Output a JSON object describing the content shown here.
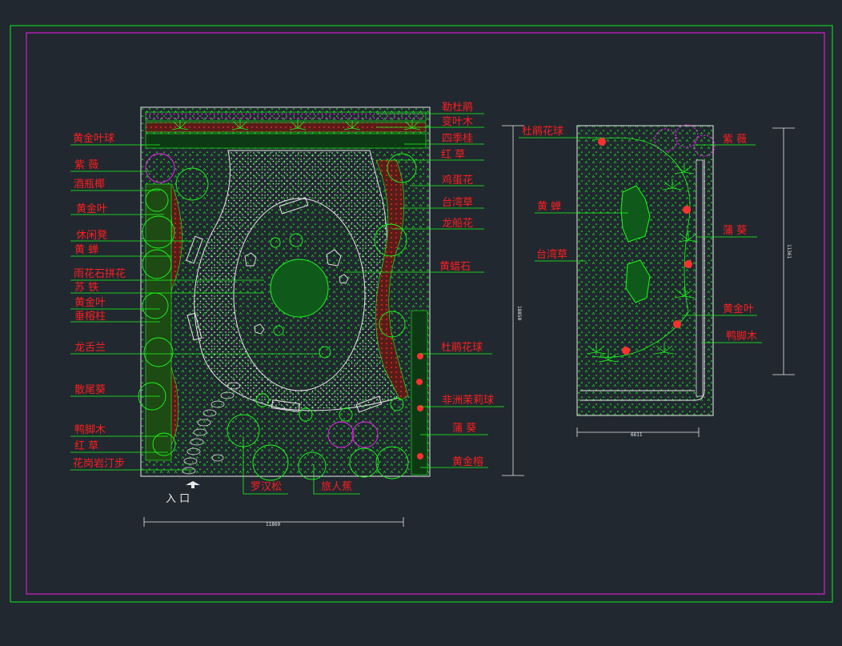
{
  "colors": {
    "background": "#212830",
    "outer_frame": "#10d020",
    "inner_frame": "#d020d0",
    "label": "#ff1e1e",
    "plant": "#18ff18",
    "white_line": "#e8e8e8",
    "magenta_plant": "#ff20ff",
    "brown_bed": "#8b2a20"
  },
  "left_plan": {
    "labels_left": [
      "黄金叶球",
      "紫 薇",
      "酒瓶椰",
      "黄金叶",
      "休闲凳",
      "黄 蝉",
      "雨花石拼花",
      "苏 铁",
      "黄金叶",
      "垂榕柱",
      "龙舌兰",
      "散尾葵",
      "鸭脚木",
      "红 草",
      "花岗岩汀步"
    ],
    "labels_right": [
      "勒杜鹃",
      "变叶木",
      "四季桂",
      "红 草",
      "鸡蛋花",
      "台湾草",
      "龙船花",
      "黄蜡石",
      "杜鹃花球",
      "非洲茉莉球",
      "蒲 葵",
      "黄金榕"
    ],
    "labels_bottom": [
      "罗汉松",
      "旅人蕉"
    ],
    "entrance": "入 口",
    "width_dim": "11860",
    "height_dim": "18850"
  },
  "right_plan": {
    "labels_left": [
      "杜鹃花球",
      "黄 蝉",
      "台湾草"
    ],
    "labels_right": [
      "紫 薇",
      "蒲 葵",
      "黄金叶",
      "鸭脚木"
    ],
    "width_dim": "6611",
    "height_dim": "11361"
  }
}
